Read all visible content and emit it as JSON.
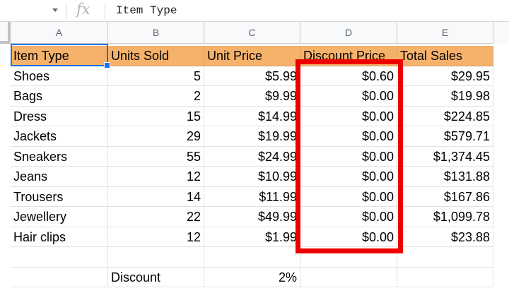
{
  "formula_bar": {
    "fx_label": "fx",
    "content": "Item Type"
  },
  "columns": [
    "A",
    "B",
    "C",
    "D",
    "E"
  ],
  "header_row": [
    "Item Type",
    "Units Sold",
    "Unit Price",
    "Discount Price",
    "Total Sales"
  ],
  "rows": [
    [
      "Shoes",
      "5",
      "$5.99",
      "$0.60",
      "$29.95"
    ],
    [
      "Bags",
      "2",
      "$9.99",
      "$0.00",
      "$19.98"
    ],
    [
      "Dress",
      "15",
      "$14.99",
      "$0.00",
      "$224.85"
    ],
    [
      "Jackets",
      "29",
      "$19.99",
      "$0.00",
      "$579.71"
    ],
    [
      "Sneakers",
      "55",
      "$24.99",
      "$0.00",
      "$1,374.45"
    ],
    [
      "Jeans",
      "12",
      "$10.99",
      "$0.00",
      "$131.88"
    ],
    [
      "Trousers",
      "14",
      "$11.99",
      "$0.00",
      "$167.86"
    ],
    [
      "Jewellery",
      "22",
      "$49.99",
      "$0.00",
      "$1,099.78"
    ],
    [
      "Hair clips",
      "12",
      "$1.99",
      "$0.00",
      "$23.88"
    ],
    [
      "",
      "",
      "",
      "",
      ""
    ],
    [
      "",
      "Discount",
      "2%",
      "",
      ""
    ]
  ],
  "highlight_color": "#ef0000",
  "header_fill": "#f6b26b",
  "selection_color": "#1a73e8"
}
